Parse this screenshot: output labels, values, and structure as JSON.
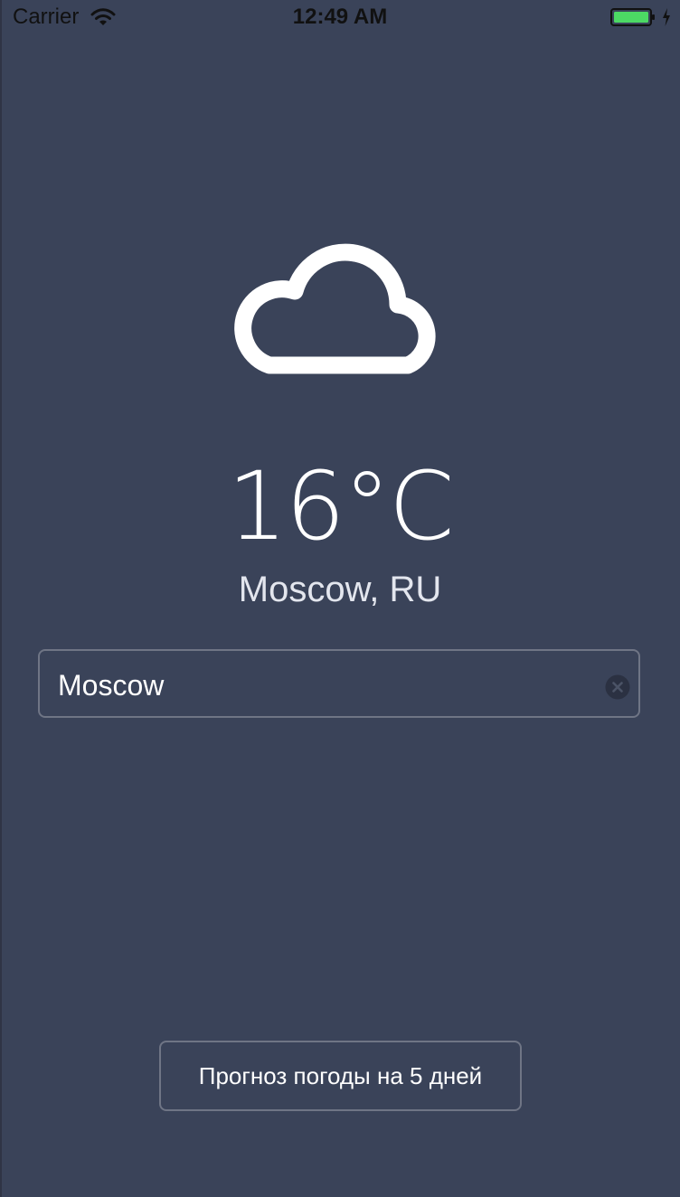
{
  "status_bar": {
    "carrier": "Carrier",
    "time": "12:49 AM",
    "icons": [
      "wifi-icon",
      "battery-icon",
      "charging-bolt-icon"
    ]
  },
  "weather": {
    "icon": "cloud-icon",
    "temperature": "16°C",
    "location": "Moscow, RU"
  },
  "search": {
    "value": "Moscow",
    "clear_icon": "clear-icon"
  },
  "actions": {
    "forecast_label": "Прогноз погоды на 5 дней"
  },
  "colors": {
    "background": "#3a4359",
    "border": "#6f7585",
    "battery": "#4cd964"
  }
}
